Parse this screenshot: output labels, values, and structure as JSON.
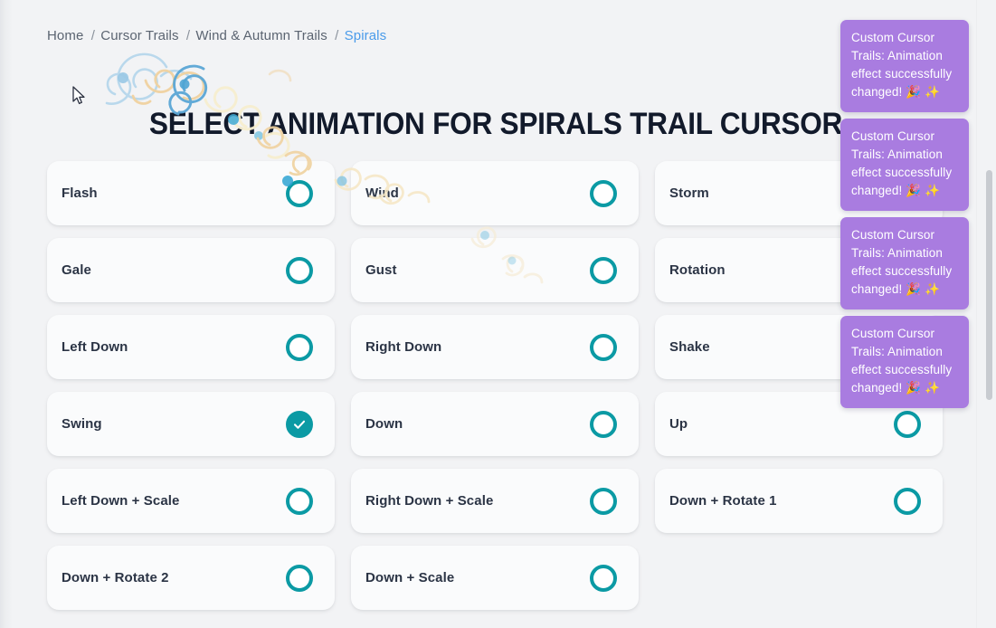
{
  "breadcrumb": {
    "separator": "/",
    "items": [
      {
        "label": "Home",
        "current": false
      },
      {
        "label": "Cursor Trails",
        "current": false
      },
      {
        "label": "Wind & Autumn Trails",
        "current": false
      },
      {
        "label": "Spirals",
        "current": true
      }
    ]
  },
  "heading": {
    "title": "SELECT ANIMATION FOR SPIRALS TRAIL CURSOR"
  },
  "options": [
    {
      "label": "Flash",
      "selected": false
    },
    {
      "label": "Wind",
      "selected": false
    },
    {
      "label": "Storm",
      "selected": false
    },
    {
      "label": "Gale",
      "selected": false
    },
    {
      "label": "Gust",
      "selected": false
    },
    {
      "label": "Rotation",
      "selected": false
    },
    {
      "label": "Left Down",
      "selected": false
    },
    {
      "label": "Right Down",
      "selected": false
    },
    {
      "label": "Shake",
      "selected": false
    },
    {
      "label": "Swing",
      "selected": true
    },
    {
      "label": "Down",
      "selected": false
    },
    {
      "label": "Up",
      "selected": false
    },
    {
      "label": "Left Down + Scale",
      "selected": false
    },
    {
      "label": "Right Down + Scale",
      "selected": false
    },
    {
      "label": "Down + Rotate 1",
      "selected": false
    },
    {
      "label": "Down + Rotate 2",
      "selected": false
    },
    {
      "label": "Down + Scale",
      "selected": false
    }
  ],
  "toasts": [
    {
      "message": "Custom Cursor Trails: Animation effect successfully changed! 🎉 ✨"
    },
    {
      "message": "Custom Cursor Trails: Animation effect successfully changed! 🎉 ✨"
    },
    {
      "message": "Custom Cursor Trails: Animation effect successfully changed! 🎉 ✨"
    },
    {
      "message": "Custom Cursor Trails: Animation effect successfully changed! 🎉 ✨"
    }
  ],
  "colors": {
    "accent_teal": "#0b9aa4",
    "toast_purple": "#a97ce0",
    "page_background": "#f2f3f5",
    "card_background": "#fafbfc",
    "label_text": "#2b3445",
    "breadcrumb_text": "#5b6471",
    "breadcrumb_current": "#4a9bea",
    "trail_blue": "#8ec4e4",
    "trail_tan": "#f0d3a0",
    "trail_cream": "#f7efd2",
    "trail_dot_teal": "#3fa9d4"
  },
  "icons": {
    "check": "check-icon",
    "radio_empty": "radio-unselected-icon",
    "radio_selected": "radio-selected-icon",
    "cursor": "mouse-cursor-icon",
    "spiral": "spiral-trail-icon"
  }
}
